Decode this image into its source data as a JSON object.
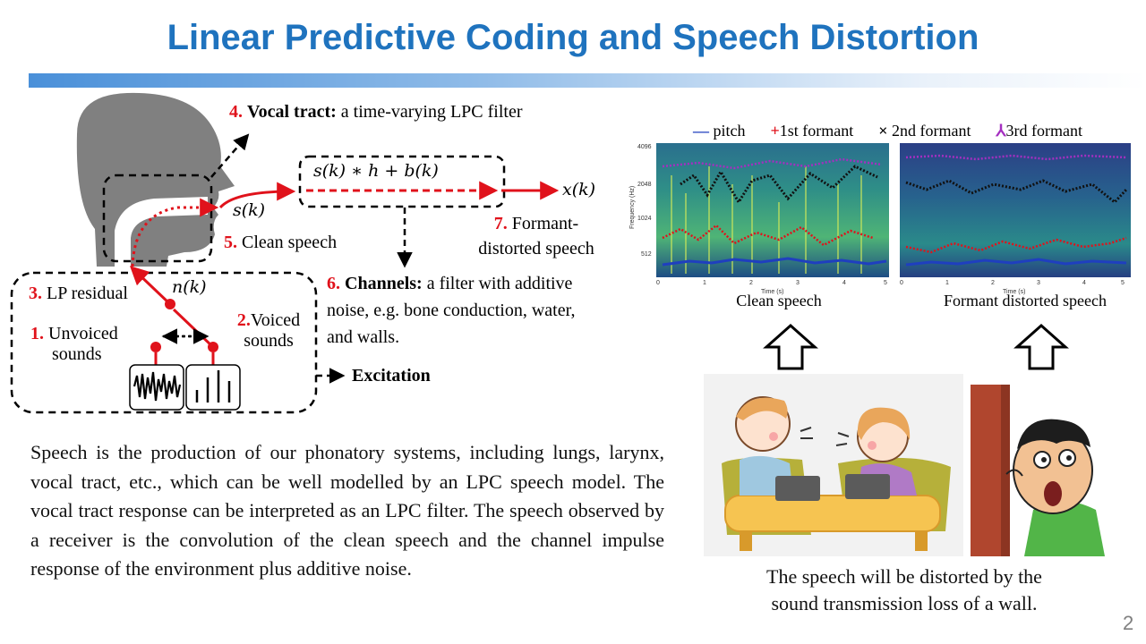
{
  "title": "Linear Predictive Coding and Speech Distortion",
  "page_number": "2",
  "colors": {
    "title": "#1f73be",
    "accent_red": "#e0121b"
  },
  "diagram": {
    "vocal_tract": {
      "num": "4.",
      "head": "Vocal tract:",
      "text": " a time-varying LPC filter"
    },
    "channel_eq": "s(k) ∗ h + b(k)",
    "s_k": "s(k)",
    "x_k": "x(k)",
    "n_k": "n(k)",
    "clean_speech": {
      "num": "5.",
      "text": " Clean speech"
    },
    "lp_residual": {
      "num": "3.",
      "text": " LP residual"
    },
    "unvoiced": {
      "num": "1.",
      "line1": " Unvoiced",
      "line2": "sounds"
    },
    "voiced": {
      "num": "2.",
      "line1": "Voiced",
      "line2": "sounds"
    },
    "excitation": "Excitation",
    "channels": {
      "num": "6.",
      "head": "Channels:",
      "line1": " a filter with additive",
      "line2": "noise, e.g. bone conduction, water,",
      "line3": "and walls."
    },
    "formant": {
      "num": "7.",
      "line1": "  Formant-",
      "line2": "distorted speech"
    }
  },
  "spectrogram": {
    "legend": [
      "pitch",
      "1st formant",
      "2nd formant",
      "3rd formant"
    ],
    "legend_markers": {
      "pitch": "—",
      "first": "+",
      "second": "×",
      "third": "⅄"
    },
    "legend_colors": [
      "#1f3fbf",
      "#e0121b",
      "#111111",
      "#a42fc0"
    ],
    "y_ticks": [
      "4096",
      "2048",
      "1024",
      "512"
    ],
    "y_label": "Frequency (Hz)",
    "x_label": "Time (s)",
    "x_ticks": [
      "0",
      "1",
      "2",
      "3",
      "4",
      "5"
    ],
    "panels": [
      "Clean speech",
      "Formant distorted speech"
    ]
  },
  "paragraph": "Speech is the production of our phonatory systems, including lungs, larynx, vocal tract, etc., which can be well modelled by an LPC speech model. The vocal tract response can be interpreted as an LPC filter. The speech observed by a receiver is the convolution of the clean speech and the channel impulse response of the environment plus additive noise.",
  "caption": {
    "line1": "The speech will be distorted by the",
    "line2": "sound transmission loss of a wall."
  }
}
